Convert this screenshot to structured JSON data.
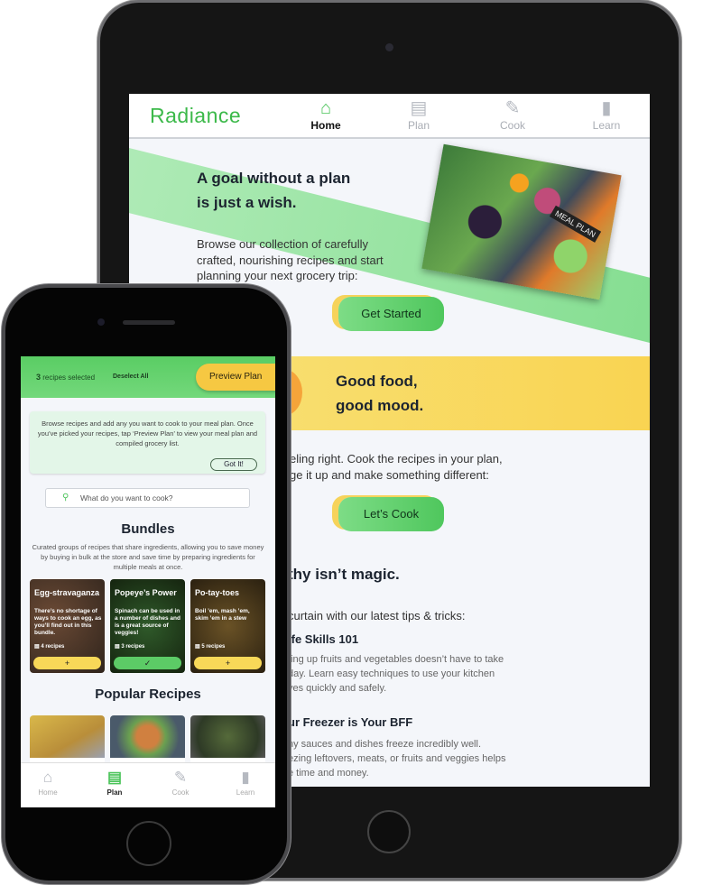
{
  "tablet": {
    "logo": "Radiance",
    "nav": [
      {
        "label": "Home",
        "icon": "home-icon",
        "active": true
      },
      {
        "label": "Plan",
        "icon": "clipboard-icon"
      },
      {
        "label": "Cook",
        "icon": "carrot-icon"
      },
      {
        "label": "Learn",
        "icon": "book-icon"
      }
    ],
    "hero": {
      "heading_1": "A goal without a plan",
      "heading_2": "is just a wish.",
      "body_1": "Browse our collection of carefully",
      "body_2": "crafted, nourishing recipes and start",
      "body_3": "planning your next grocery trip:",
      "image_tag": "MEAL PLAN",
      "button": "Get Started"
    },
    "mood": {
      "heading_1": "Good food,",
      "heading_2": "good mood.",
      "body_1": "eling right.  Cook the recipes in your plan,",
      "body_2": "ge it up and make something different:",
      "button": "Let’s Cook"
    },
    "tips": {
      "heading": "thy isn’t magic.",
      "intro": "curtain with our latest tips & tricks:",
      "items": [
        {
          "title": "ife Skills 101",
          "lines": [
            "ting up fruits and vegetables doesn’t have to take",
            "day.  Learn easy techniques to use your kitchen",
            "ves quickly and safely."
          ]
        },
        {
          "title": "ur Freezer is Your BFF",
          "lines": [
            "ny sauces and dishes freeze incredibly well.",
            "ezing leftovers, meats, or fruits and veggies helps",
            "e time and money."
          ]
        }
      ]
    }
  },
  "phone": {
    "count": "3",
    "selected_label": "recipes selected",
    "deselect": "Deselect All",
    "preview": "Preview Plan",
    "info": "Browse recipes and add any you want to cook to your meal plan.  Once you’ve picked your recipes, tap ‘Preview Plan’ to view your meal plan and compiled grocery list.",
    "got_it": "Got It!",
    "search_placeholder": "What do you want to cook?",
    "bundles_title": "Bundles",
    "bundles_desc": "Curated groups of recipes that share ingredients, allowing you to save money by buying in bulk at the store and save time by preparing ingredients for multiple meals at once.",
    "bundles": [
      {
        "title": "Egg-stravaganza",
        "desc": "There’s no shortage of ways to cook an egg, as you’ll find out in this bundle.",
        "count": "4 recipes",
        "action": "+",
        "selected": false
      },
      {
        "title": "Popeye’s Power",
        "desc": "Spinach can be used in a number of dishes and is a great source of veggies!",
        "count": "3 recipes",
        "action": "✓",
        "selected": true
      },
      {
        "title": "Po-tay-toes",
        "desc": "Boil ’em, mash ’em, skim ’em in a stew",
        "count": "5 recipes",
        "action": "+",
        "selected": false
      }
    ],
    "popular_title": "Popular Recipes",
    "nav": [
      {
        "label": "Home",
        "icon": "home-icon"
      },
      {
        "label": "Plan",
        "icon": "clipboard-icon",
        "active": true
      },
      {
        "label": "Cook",
        "icon": "carrot-icon"
      },
      {
        "label": "Learn",
        "icon": "book-icon"
      }
    ]
  },
  "colors": {
    "brand_green": "#3cb94a",
    "accent_yellow": "#f6c842"
  }
}
